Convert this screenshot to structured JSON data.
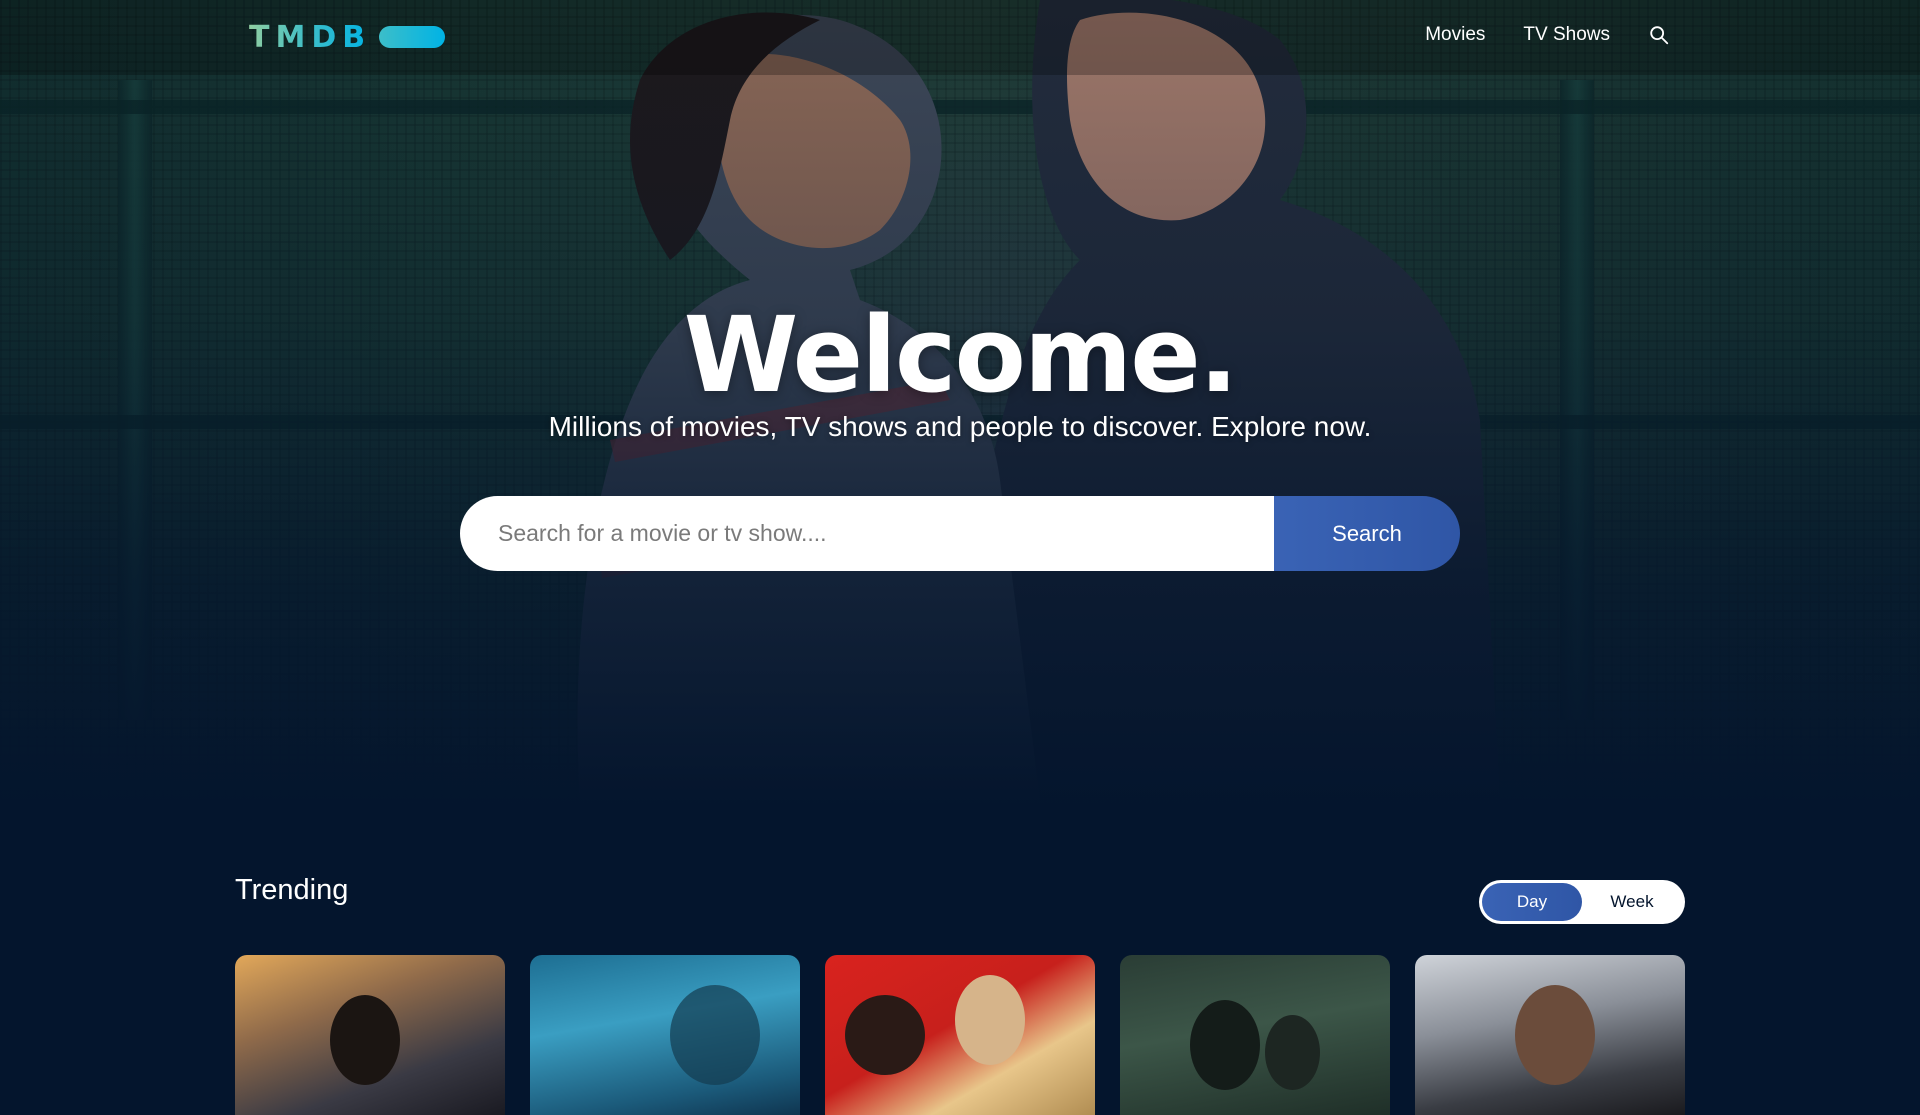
{
  "header": {
    "logo_text": "TMDB",
    "nav": [
      {
        "label": "Movies"
      },
      {
        "label": "TV Shows"
      }
    ]
  },
  "hero": {
    "title": "Welcome.",
    "subtitle": "Millions of movies, TV shows and people to discover. Explore now.",
    "search": {
      "placeholder": "Search for a movie or tv show....",
      "value": "",
      "button_label": "Search"
    }
  },
  "trending": {
    "title": "Trending",
    "tabs": [
      {
        "label": "Day",
        "active": true
      },
      {
        "label": "Week",
        "active": false
      }
    ],
    "cards_visible": 5
  },
  "colors": {
    "background": "#04152d",
    "accent_gradient_start": "#3a63b5",
    "accent_gradient_end": "#2f56a6",
    "logo_gradient": [
      "#90cea1",
      "#3cbec9",
      "#00b3e5"
    ]
  },
  "icons": {
    "header_search": "search-icon"
  }
}
